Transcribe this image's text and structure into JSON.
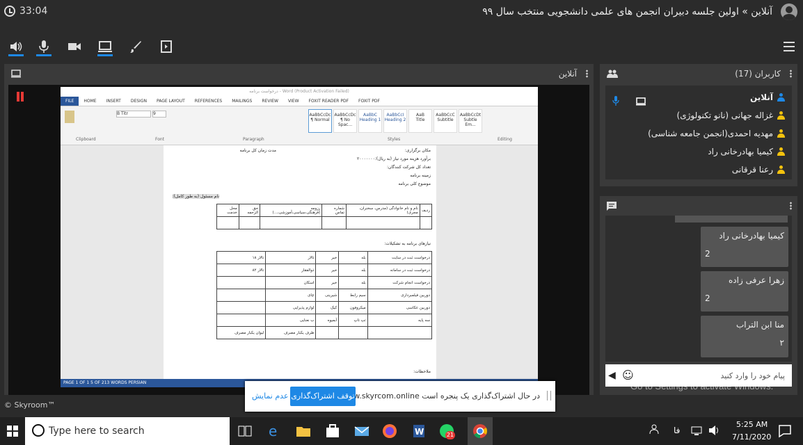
{
  "window": {
    "timer": "33:04",
    "room_title": "آنلاین » اولین جلسه دبیران انجمن های علمی دانشجویی منتخب سال ۹۹"
  },
  "toolbar": {
    "icons": [
      "speaker-icon",
      "microphone-icon",
      "camera-icon",
      "screen-share-icon",
      "whiteboard-icon",
      "file-icon"
    ],
    "accent": "#1e88e5"
  },
  "stage_panel": {
    "title": "آنلاین"
  },
  "users_panel": {
    "title": "کاربران (17)",
    "users": [
      {
        "name": "آنلاین",
        "color": "#1e88e5"
      },
      {
        "name": "غزاله جهانی (نانو تکنولوژی)",
        "color": "#f4c20d"
      },
      {
        "name": "مهدیه احمدی(انجمن جامعه شناسی)",
        "color": "#f4c20d"
      },
      {
        "name": "کیمیا بهادرخانی راد",
        "color": "#f4c20d"
      },
      {
        "name": "رعنا قرقانی",
        "color": "#f4c20d"
      }
    ]
  },
  "chat_panel": {
    "messages": [
      {
        "name": "کیمیا بهادرخانی راد",
        "text": "2"
      },
      {
        "name": "زهرا عرفی زاده",
        "text": "2"
      },
      {
        "name": "منا ابن التراب",
        "text": "۲"
      }
    ],
    "input_placeholder": "پیام خود را وارد کنید"
  },
  "word_doc": {
    "title_bar": "درخواست برنامه - Word (Product Activation Failed)",
    "tabs": [
      "FILE",
      "HOME",
      "INSERT",
      "DESIGN",
      "PAGE LAYOUT",
      "REFERENCES",
      "MAILINGS",
      "REVIEW",
      "VIEW",
      "FOXIT READER PDF",
      "FOXIT PDF"
    ],
    "font_name": "B Titr",
    "font_size": "9",
    "groups": [
      "Clipboard",
      "Font",
      "Paragraph",
      "Styles",
      "Editing"
    ],
    "styles": [
      "AaBbCcDc",
      "AaBbCcDc",
      "AaBbC",
      "AaBbCcI",
      "AaB",
      "AaBbCcC",
      "AaBbCcDt"
    ],
    "style_names": [
      "¶ Normal",
      "¶ No Spac...",
      "Heading 1",
      "Heading 2",
      "Title",
      "Subtitle",
      "Subtle Em..."
    ],
    "status": "PAGE 1 OF 1   5 OF 213 WORDS   PERSIAN",
    "lines": [
      "مکان برگزاری:",
      "مدت زمان کل برنامه",
      "برآورد هزینه مورد نیاز (به ریال):۲۰۰۰۰۰۰۰",
      "تعداد کل شرکت کنندگان:",
      "زمینه برنامه",
      "موضوع کلی برنامه",
      "نام مسئول (به طور کامل):",
      "نیازهای برنامه به تشکیلات:",
      "ملاحظات:"
    ],
    "table1_headers": [
      "ردیف",
      "نام و نام خانوادگی (مدرس، سخنران، مجری)",
      "شماره تماس",
      "رزومه (فرهنگی،سیاسی،آموزشی،...)",
      "حق الزحمه",
      "محل خدمت"
    ],
    "table2_rows": [
      [
        "درخواست ثبت در سایت",
        "بله",
        "خیر",
        "تالار",
        "تالار ۱۸"
      ],
      [
        "درخواست ثبت در سامانه",
        "بله",
        "خیر",
        "ذوالفقار",
        "تالار ۸۲"
      ],
      [
        "درخواست انجام شرکت",
        "بله",
        "خیر",
        "اسکان",
        ""
      ],
      [
        "دوربین فیلمبرداری",
        "سیم رابط",
        "شیرینی",
        "چای",
        ""
      ],
      [
        "دوربین عکاسی",
        "میکروفون",
        "کیک",
        "لوازم پذیرایی",
        ""
      ],
      [
        "سه پایه",
        "تپ تاپ",
        "آبمیوه",
        "ب نعنایی",
        ""
      ],
      [
        "",
        "",
        "",
        "ظرف یکبار مصرف",
        "لیوان یکبار مصرف"
      ]
    ]
  },
  "share_bar": {
    "message": "در حال اشتراک‌گذاری یک پنجره است www.skyrcom.online",
    "stop_label": "توقف اشتراک‌گذاری",
    "hide_label": "عدم نمایش"
  },
  "footer": "© Skyroom™",
  "watermark": {
    "line1": "Activate Windows",
    "line2": "Go to Settings to activate Windows."
  },
  "taskbar": {
    "search_placeholder": "Type here to search",
    "time": "5:25 AM",
    "date": "7/11/2020",
    "lang": "فا",
    "badge": "21"
  }
}
